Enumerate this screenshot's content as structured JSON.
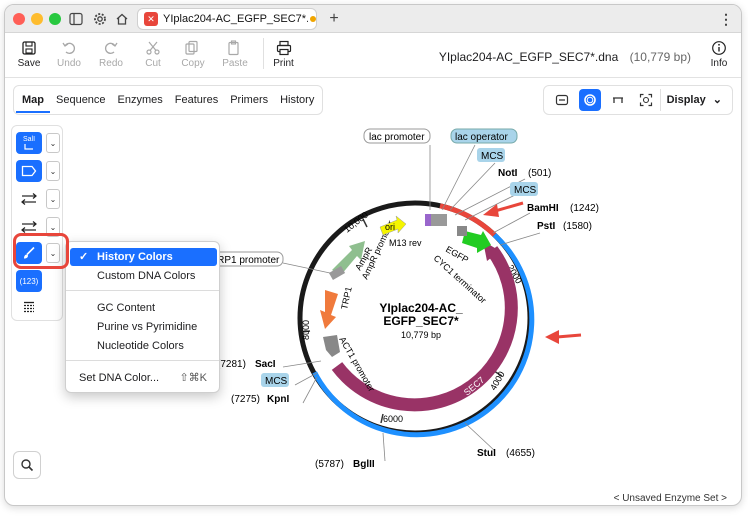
{
  "window": {
    "tab_title": "YIplac204-AC_EGFP_SEC7*.dna",
    "file_title": "YIplac204-AC_EGFP_SEC7*.dna",
    "length_label": "(10,779 bp)"
  },
  "toolbar": {
    "save": "Save",
    "undo": "Undo",
    "redo": "Redo",
    "cut": "Cut",
    "copy": "Copy",
    "paste": "Paste",
    "print": "Print",
    "info": "Info"
  },
  "tabs": [
    "Map",
    "Sequence",
    "Enzymes",
    "Features",
    "Primers",
    "History"
  ],
  "view": {
    "display_label": "Display"
  },
  "side": {
    "sall_label": "SalI",
    "count_label": "(123)"
  },
  "menu": {
    "items": [
      "History Colors",
      "Custom DNA Colors",
      "GC Content",
      "Purine vs Pyrimidine",
      "Nucleotide Colors",
      "Set DNA Color..."
    ],
    "shortcut": "⇧⌘K"
  },
  "map": {
    "name_line1": "YIplac204-AC_",
    "name_line2": "EGFP_SEC7*",
    "length": "10,779 bp",
    "ticks": [
      "2000",
      "4000",
      "6000",
      "8000",
      "10,000"
    ],
    "features": {
      "ori": "ori",
      "m13": "M13 rev",
      "egfp": "EGFP",
      "cyc1": "CYC1 terminator",
      "sec7": "SEC7",
      "act1": "ACT1 promoter",
      "trp1": "TRP1",
      "ampr": "AmpR",
      "ampr_promoter": "AmpR promoter"
    },
    "labels": {
      "lac_promoter": "lac promoter",
      "lac_operator": "lac operator",
      "mcs": "MCS",
      "trp1_promoter": "TRP1 promoter",
      "noti": "NotI",
      "noti_pos": "(501)",
      "bamhi": "BamHI",
      "bamhi_pos": "(1242)",
      "psti": "PstI",
      "psti_pos": "(1580)",
      "saci": "SacI",
      "saci_pos": "(7281)",
      "kpni": "KpnI",
      "kpni_pos": "(7275)",
      "bglii": "BglII",
      "bglii_pos": "(5787)",
      "stui": "StuI",
      "stui_pos": "(4655)"
    }
  },
  "status": {
    "enzyme_set": "< Unsaved Enzyme Set >"
  },
  "colors": {
    "accent": "#1a6fff",
    "history_blue": "#1e90ff",
    "sec7": "#993366",
    "red": "#e8463b"
  }
}
